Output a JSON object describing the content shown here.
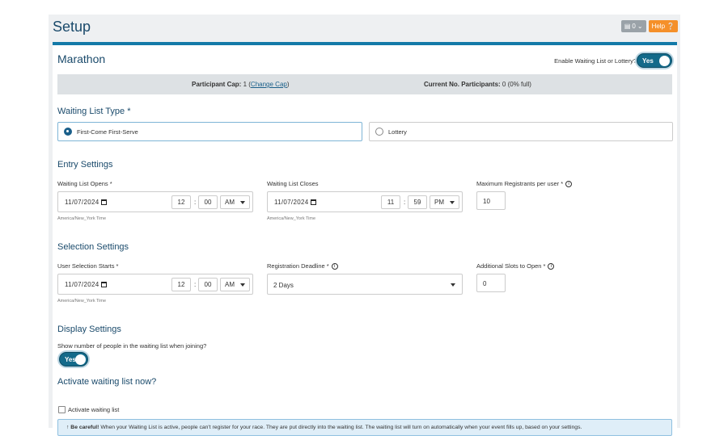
{
  "header": {
    "title": "Setup",
    "counter_label": "0",
    "help_label": "Help"
  },
  "race": {
    "name": "Marathon",
    "waiting_list_toggle_label": "Enable Waiting List or Lottery?",
    "waiting_list_toggle_value": "Yes"
  },
  "cap_bar": {
    "cap_prefix": "Participant Cap:",
    "cap_value": "1",
    "change_cap_link": "Change Cap",
    "current_prefix": "Current No. Participants:",
    "current_value": "0 (0% full)"
  },
  "waiting_list_type": {
    "title": "Waiting List Type *",
    "options": [
      {
        "label": "First-Come First-Serve",
        "selected": true
      },
      {
        "label": "Lottery",
        "selected": false
      }
    ]
  },
  "entry_settings": {
    "title": "Entry Settings",
    "opens": {
      "label": "Waiting List Opens *",
      "date": "11/07/2024",
      "hour": "12",
      "minute": "00",
      "ampm": "AM",
      "timezone": "America/New_York Time"
    },
    "closes": {
      "label": "Waiting List Closes",
      "date": "11/07/2024",
      "hour": "11",
      "minute": "59",
      "ampm": "PM",
      "timezone": "America/New_York Time"
    },
    "max_registrants": {
      "label": "Maximum Registrants per user *",
      "value": "10"
    }
  },
  "selection_settings": {
    "title": "Selection Settings",
    "starts": {
      "label": "User Selection Starts *",
      "date": "11/07/2024",
      "hour": "12",
      "minute": "00",
      "ampm": "AM",
      "timezone": "America/New_York Time"
    },
    "deadline": {
      "label": "Registration Deadline *",
      "value": "2 Days"
    },
    "additional_slots": {
      "label": "Additional Slots to Open *",
      "value": "0"
    }
  },
  "display_settings": {
    "title": "Display Settings",
    "show_count_label": "Show number of people in the waiting list when joining?",
    "show_count_value": "Yes"
  },
  "activate": {
    "title": "Activate waiting list now?",
    "checkbox_label": "Activate waiting list",
    "checked": false
  },
  "alert": {
    "icon": "up-arrow-icon",
    "bold": "Be careful!",
    "text": " When your Waiting List is active, people can't register for your race. They are put directly into the waiting list. The waiting list will turn on automatically when your event fills up, based on your settings."
  },
  "colors": {
    "primary": "#137aa8",
    "title": "#1a4a6b",
    "help_button": "#f5902a",
    "alert_bg": "#dfeef8"
  }
}
